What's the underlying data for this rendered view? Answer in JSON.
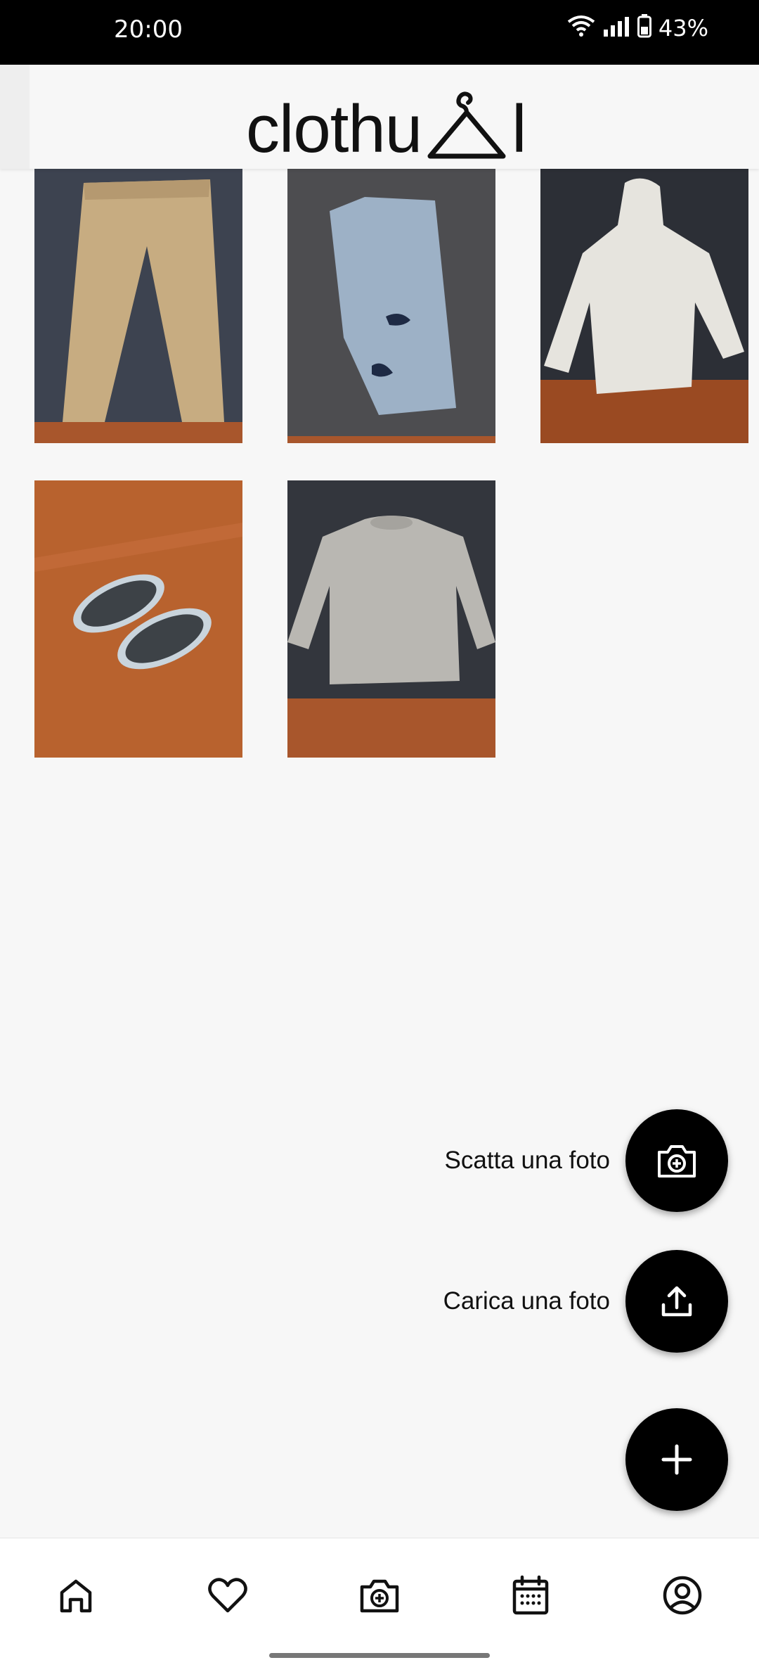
{
  "status_bar": {
    "time": "20:00",
    "battery": "43%",
    "icons": [
      "wifi-icon",
      "signal-icon",
      "battery-icon"
    ]
  },
  "header": {
    "logo_text_left": "clothu",
    "logo_text_right": "l",
    "logo_icon": "hanger-icon"
  },
  "wardrobe": {
    "items": [
      {
        "name": "beige-trousers"
      },
      {
        "name": "ripped-denim-shorts"
      },
      {
        "name": "white-hoodie"
      },
      {
        "name": "grey-slippers"
      },
      {
        "name": "grey-knit-sweater"
      }
    ]
  },
  "fab_menu": {
    "take_photo_label": "Scatta una foto",
    "upload_photo_label": "Carica una foto",
    "take_photo_icon": "camera-add-icon",
    "upload_photo_icon": "upload-icon",
    "main_icon": "plus-icon"
  },
  "bottom_nav": {
    "items": [
      "home-icon",
      "heart-icon",
      "camera-add-icon",
      "calendar-icon",
      "account-icon"
    ]
  },
  "colors": {
    "background": "#f7f7f7",
    "fab": "#000000",
    "status_bar": "#000000"
  }
}
